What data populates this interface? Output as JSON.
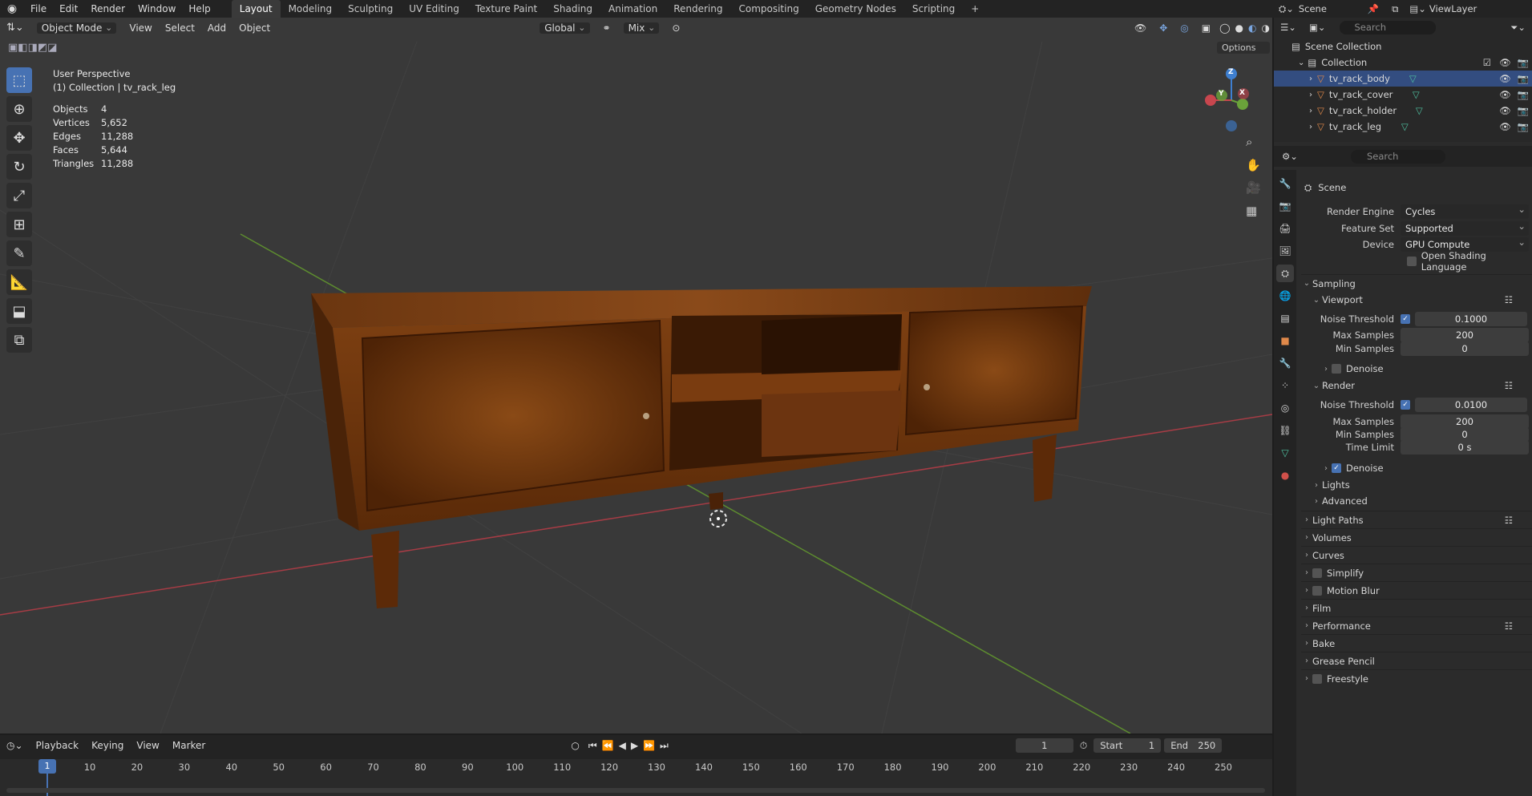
{
  "app_menu": [
    "File",
    "Edit",
    "Render",
    "Window",
    "Help"
  ],
  "workspaces": [
    "Layout",
    "Modeling",
    "Sculpting",
    "UV Editing",
    "Texture Paint",
    "Shading",
    "Animation",
    "Rendering",
    "Compositing",
    "Geometry Nodes",
    "Scripting"
  ],
  "workspace_active": "Layout",
  "top_right": {
    "scene": "Scene",
    "view_layer": "ViewLayer"
  },
  "viewport_header": {
    "mode": "Object Mode",
    "menus": [
      "View",
      "Select",
      "Add",
      "Object"
    ],
    "orientation": "Global",
    "snap": "Mix",
    "options": "Options"
  },
  "overlay": {
    "title": "User Perspective",
    "subtitle": "(1) Collection | tv_rack_leg",
    "stats": [
      {
        "label": "Objects",
        "value": "4"
      },
      {
        "label": "Vertices",
        "value": "5,652"
      },
      {
        "label": "Edges",
        "value": "11,288"
      },
      {
        "label": "Faces",
        "value": "5,644"
      },
      {
        "label": "Triangles",
        "value": "11,288"
      }
    ]
  },
  "gizmo": {
    "x": "X",
    "y": "Y",
    "z": "Z"
  },
  "outliner": {
    "search_placeholder": "Search",
    "scene_collection": "Scene Collection",
    "collection": "Collection",
    "objects": [
      "tv_rack_body",
      "tv_rack_cover",
      "tv_rack_holder",
      "tv_rack_leg"
    ]
  },
  "properties": {
    "search_placeholder": "Search",
    "context": "Scene",
    "render_engine_label": "Render Engine",
    "render_engine": "Cycles",
    "feature_set_label": "Feature Set",
    "feature_set": "Supported",
    "device_label": "Device",
    "device": "GPU Compute",
    "osl_label": "Open Shading Language",
    "sampling": "Sampling",
    "viewport": "Viewport",
    "noise_threshold_label": "Noise Threshold",
    "viewport_noise_threshold": "0.1000",
    "max_samples_label": "Max Samples",
    "viewport_max_samples": "200",
    "min_samples_label": "Min Samples",
    "viewport_min_samples": "0",
    "denoise_label": "Denoise",
    "render": "Render",
    "render_noise_threshold": "0.0100",
    "render_max_samples": "200",
    "render_min_samples": "0",
    "time_limit_label": "Time Limit",
    "time_limit": "0 s",
    "sub_sections": [
      "Lights",
      "Advanced"
    ],
    "sections": [
      "Light Paths",
      "Volumes",
      "Curves",
      "Simplify",
      "Motion Blur",
      "Film",
      "Performance",
      "Bake",
      "Grease Pencil",
      "Freestyle"
    ]
  },
  "timeline": {
    "menus": [
      "Playback",
      "Keying",
      "View",
      "Marker"
    ],
    "current_frame": "1",
    "start_label": "Start",
    "start": "1",
    "end_label": "End",
    "end": "250",
    "ticks": [
      "1",
      "10",
      "20",
      "30",
      "40",
      "50",
      "60",
      "70",
      "80",
      "90",
      "100",
      "110",
      "120",
      "130",
      "140",
      "150",
      "160",
      "170",
      "180",
      "190",
      "200",
      "210",
      "220",
      "230",
      "240",
      "250"
    ]
  },
  "colors": {
    "accent": "#4772b3",
    "x_axis": "#c8464e",
    "y_axis": "#6aa33a",
    "z_axis": "#3e7fd0",
    "wood": "#7a3f12"
  }
}
